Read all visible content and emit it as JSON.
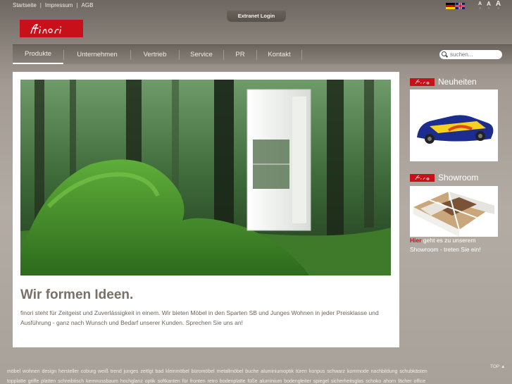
{
  "toplinks": {
    "home": "Startseite",
    "imprint": "Impressum",
    "terms": "AGB"
  },
  "languages": [
    "de-flag",
    "en-flag"
  ],
  "fontsizes": [
    "A",
    "A",
    "A"
  ],
  "extranet_label": "Extranet Login",
  "logo_alt": "finori",
  "nav": {
    "items": [
      "Produkte",
      "Unternehmen",
      "Vertrieb",
      "Service",
      "PR",
      "Kontakt"
    ],
    "active": "Produkte"
  },
  "search": {
    "placeholder": "suchen..."
  },
  "main": {
    "headline": "Wir formen Ideen.",
    "intro": "finori steht für Zeitgeist und Zuverlässigkeit in einem. Wir bieten Möbel in den Sparten SB und Junges Wohnen in jeder Preisklasse und Ausführung - ganz nach Wunsch und Bedarf unserer Kunden. Sprechen Sie uns an!"
  },
  "side": {
    "news_title": "Neuheiten",
    "showroom_title": "Showroom",
    "showroom_link": "Hier",
    "showroom_text": " geht es zu unserem Showroom - treten Sie ein!"
  },
  "footer": {
    "top_label": "TOP",
    "tags_line1": "möbel wohnen design hersteller coburg weiß trend junges zeitlgt bad kleinmöbel büromöbel metallmöbel buche aluminiumoptik türen konpus schwarz kommode nachbildung schubkästen",
    "tags_line2": "topplatte griffe platten schreibtisch kernnussbaum hochglanz optik softkanten für fronten retro bodenplatte füße aluminium bodengleiter spiegel sicherheitsglas schoko ahorn fächer office"
  },
  "colors": {
    "brand": "#c8101a",
    "nav_text": "#f0ebe6"
  }
}
